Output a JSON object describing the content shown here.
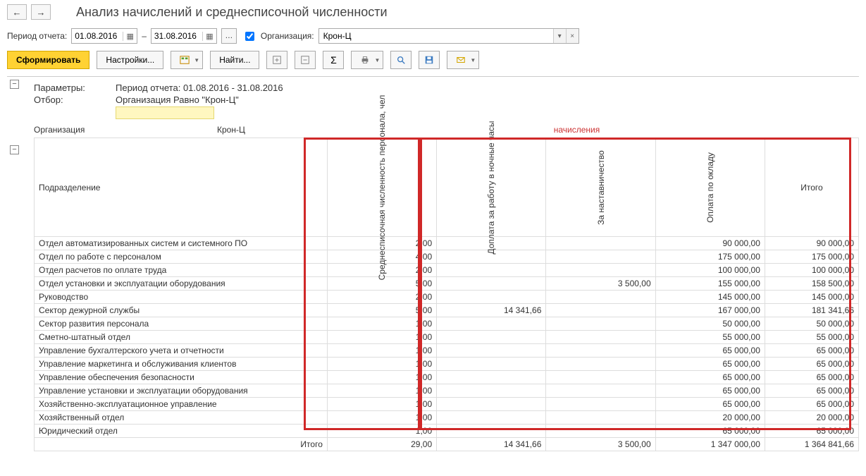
{
  "title": "Анализ начислений и среднесписочной численности",
  "period": {
    "label": "Период отчета:",
    "from": "01.08.2016",
    "to": "31.08.2016",
    "dash": "–"
  },
  "org_filter": {
    "checkbox_label": "Организация:",
    "checked": true,
    "value": "Крон-Ц"
  },
  "toolbar": {
    "generate": "Сформировать",
    "settings": "Настройки...",
    "find": "Найти..."
  },
  "params": {
    "header": "Параметры:",
    "period_text": "Период отчета: 01.08.2016 - 31.08.2016",
    "filter_label": "Отбор:",
    "filter_text": "Организация Равно \"Крон-Ц\""
  },
  "org_row": {
    "label": "Организация",
    "value": "Крон-Ц",
    "group_header": "начисления"
  },
  "columns": {
    "dept": "Подразделение",
    "headcount": "Среднесписочная численность персонала, чел",
    "night": "Доплата за работу в ночные часы",
    "mentor": "За наставничество",
    "salary": "Оплата по окладу",
    "total": "Итого"
  },
  "rows": [
    {
      "dept": "Отдел автоматизированных систем и системного ПО",
      "hc": "2,00",
      "night": "",
      "mentor": "",
      "salary": "90 000,00",
      "total": "90 000,00"
    },
    {
      "dept": "Отдел по работе с персоналом",
      "hc": "4,00",
      "night": "",
      "mentor": "",
      "salary": "175 000,00",
      "total": "175 000,00"
    },
    {
      "dept": "Отдел расчетов по оплате труда",
      "hc": "2,00",
      "night": "",
      "mentor": "",
      "salary": "100 000,00",
      "total": "100 000,00"
    },
    {
      "dept": "Отдел установки и эксплуатации оборудования",
      "hc": "5,00",
      "night": "",
      "mentor": "3 500,00",
      "salary": "155 000,00",
      "total": "158 500,00"
    },
    {
      "dept": "Руководство",
      "hc": "2,00",
      "night": "",
      "mentor": "",
      "salary": "145 000,00",
      "total": "145 000,00"
    },
    {
      "dept": "Сектор дежурной службы",
      "hc": "5,00",
      "night": "14 341,66",
      "mentor": "",
      "salary": "167 000,00",
      "total": "181 341,66"
    },
    {
      "dept": "Сектор развития персонала",
      "hc": "1,00",
      "night": "",
      "mentor": "",
      "salary": "50 000,00",
      "total": "50 000,00"
    },
    {
      "dept": "Сметно-штатный отдел",
      "hc": "1,00",
      "night": "",
      "mentor": "",
      "salary": "55 000,00",
      "total": "55 000,00"
    },
    {
      "dept": "Управление бухгалтерского учета и отчетности",
      "hc": "1,00",
      "night": "",
      "mentor": "",
      "salary": "65 000,00",
      "total": "65 000,00"
    },
    {
      "dept": "Управление маркетинга и обслуживания клиентов",
      "hc": "1,00",
      "night": "",
      "mentor": "",
      "salary": "65 000,00",
      "total": "65 000,00"
    },
    {
      "dept": "Управление обеспечения безопасности",
      "hc": "1,00",
      "night": "",
      "mentor": "",
      "salary": "65 000,00",
      "total": "65 000,00"
    },
    {
      "dept": "Управление установки и эксплуатации оборудования",
      "hc": "1,00",
      "night": "",
      "mentor": "",
      "salary": "65 000,00",
      "total": "65 000,00"
    },
    {
      "dept": "Хозяйственно-эксплуатационное управление",
      "hc": "1,00",
      "night": "",
      "mentor": "",
      "salary": "65 000,00",
      "total": "65 000,00"
    },
    {
      "dept": "Хозяйственный отдел",
      "hc": "1,00",
      "night": "",
      "mentor": "",
      "salary": "20 000,00",
      "total": "20 000,00"
    },
    {
      "dept": "Юридический отдел",
      "hc": "1,00",
      "night": "",
      "mentor": "",
      "salary": "65 000,00",
      "total": "65 000,00"
    }
  ],
  "totals": {
    "label": "Итого",
    "hc": "29,00",
    "night": "14 341,66",
    "mentor": "3 500,00",
    "salary": "1 347 000,00",
    "total": "1 364 841,66"
  }
}
